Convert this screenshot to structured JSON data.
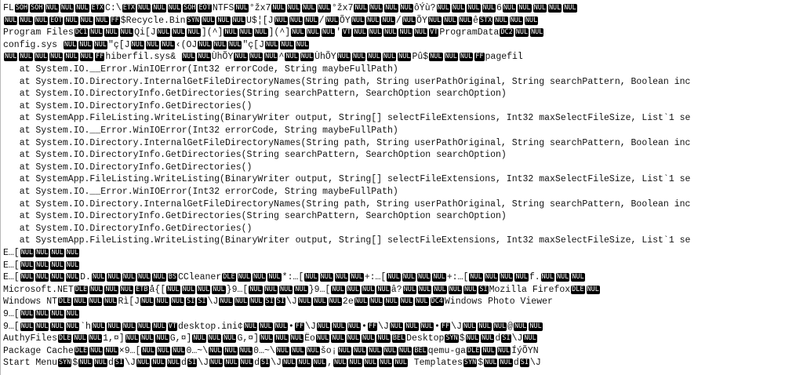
{
  "lines": [
    [
      {
        "c": "FL"
      },
      {
        "k": "SOH"
      },
      {
        "k": "SOH"
      },
      {
        "k": "NUL"
      },
      {
        "k": "NUL"
      },
      {
        "k": "NUL"
      },
      {
        "k": "ETX"
      },
      {
        "t": "C:\\"
      },
      {
        "k": "ETX"
      },
      {
        "k": "NUL"
      },
      {
        "k": "NUL"
      },
      {
        "k": "NUL"
      },
      {
        "k": "SOH"
      },
      {
        "k": "EOT"
      },
      {
        "t": "NTFS"
      },
      {
        "k": "NUL"
      },
      {
        "t": "°žx7"
      },
      {
        "k": "NUL"
      },
      {
        "k": "NUL"
      },
      {
        "k": "NUL"
      },
      {
        "k": "NUL"
      },
      {
        "t": "°žx7"
      },
      {
        "k": "NUL"
      },
      {
        "k": "NUL"
      },
      {
        "k": "NUL"
      },
      {
        "k": "NUL"
      },
      {
        "t": "ôÝù?"
      },
      {
        "k": "NUL"
      },
      {
        "k": "NUL"
      },
      {
        "k": "NUL"
      },
      {
        "k": "NUL"
      },
      {
        "t": "6"
      },
      {
        "k": "NUL"
      },
      {
        "k": "NUL"
      },
      {
        "k": "NUL"
      },
      {
        "k": "NUL"
      },
      {
        "k": "NUL"
      }
    ],
    [
      {
        "k": "NUL"
      },
      {
        "k": "NUL"
      },
      {
        "k": "NUL"
      },
      {
        "k": "EOT"
      },
      {
        "k": "NUL"
      },
      {
        "k": "NUL"
      },
      {
        "k": "NUL"
      },
      {
        "k": "FF"
      },
      {
        "t": "$Recycle.Bin"
      },
      {
        "k": "SYN"
      },
      {
        "k": "NUL"
      },
      {
        "k": "NUL"
      },
      {
        "k": "NUL"
      },
      {
        "t": "U$¦[J"
      },
      {
        "k": "NUL"
      },
      {
        "k": "NUL"
      },
      {
        "k": "NUL"
      },
      {
        "t": "/"
      },
      {
        "k": "NUL"
      },
      {
        "t": "ÕY"
      },
      {
        "k": "NUL"
      },
      {
        "k": "NUL"
      },
      {
        "k": "NUL"
      },
      {
        "t": "/"
      },
      {
        "k": "NUL"
      },
      {
        "t": "ÕY"
      },
      {
        "k": "NUL"
      },
      {
        "k": "NUL"
      },
      {
        "k": "NUL"
      },
      {
        "t": "ê"
      },
      {
        "k": "STX"
      },
      {
        "k": "NUL"
      },
      {
        "k": "NUL"
      },
      {
        "k": "NUL"
      }
    ],
    [
      {
        "t": "Program Files"
      },
      {
        "k": "DC1"
      },
      {
        "k": "NUL"
      },
      {
        "k": "NUL"
      },
      {
        "k": "NUL"
      },
      {
        "t": "Qi[J"
      },
      {
        "k": "NUL"
      },
      {
        "k": "NUL"
      },
      {
        "k": "NUL"
      },
      {
        "t": "](^]"
      },
      {
        "k": "NUL"
      },
      {
        "k": "NUL"
      },
      {
        "k": "NUL"
      },
      {
        "t": "](^]"
      },
      {
        "k": "NUL"
      },
      {
        "k": "NUL"
      },
      {
        "k": "NUL"
      },
      {
        "t": "'"
      },
      {
        "k": "VT"
      },
      {
        "k": "NUL"
      },
      {
        "k": "NUL"
      },
      {
        "k": "NUL"
      },
      {
        "k": "NUL"
      },
      {
        "k": "NUL"
      },
      {
        "k": "VT"
      },
      {
        "t": "ProgramData"
      },
      {
        "k": "DC2"
      },
      {
        "k": "NUL"
      },
      {
        "k": "NUL"
      }
    ],
    [
      {
        "t": "config.sys "
      },
      {
        "k": "NUL"
      },
      {
        "k": "NUL"
      },
      {
        "k": "NUL"
      },
      {
        "t": "\"ç[J"
      },
      {
        "k": "NUL"
      },
      {
        "k": "NUL"
      },
      {
        "k": "NUL"
      },
      {
        "t": "‹(OJ"
      },
      {
        "k": "NUL"
      },
      {
        "k": "NUL"
      },
      {
        "k": "NUL"
      },
      {
        "t": "\"ç[J"
      },
      {
        "k": "NUL"
      },
      {
        "k": "NUL"
      },
      {
        "k": "NUL"
      }
    ],
    [
      {
        "k": "NUL"
      },
      {
        "k": "NUL"
      },
      {
        "k": "NUL"
      },
      {
        "k": "NUL"
      },
      {
        "k": "NUL"
      },
      {
        "k": "NUL"
      },
      {
        "k": "FF"
      },
      {
        "t": "hiberfil.sys& "
      },
      {
        "k": "NUL"
      },
      {
        "k": "NUL"
      },
      {
        "t": "ÙhÕY"
      },
      {
        "k": "NUL"
      },
      {
        "k": "NUL"
      },
      {
        "k": "NUL"
      },
      {
        "t": "^"
      },
      {
        "k": "NUL"
      },
      {
        "k": "NUL"
      },
      {
        "t": "ÙhÕY"
      },
      {
        "k": "NUL"
      },
      {
        "k": "NUL"
      },
      {
        "k": "NUL"
      },
      {
        "k": "NUL"
      },
      {
        "k": "NUL"
      },
      {
        "t": "Pû$"
      },
      {
        "k": "NUL"
      },
      {
        "k": "NUL"
      },
      {
        "k": "NUL"
      },
      {
        "k": "FF"
      },
      {
        "t": "pagefil"
      }
    ],
    [
      {
        "t": "   at System.IO.__Error.WinIOError(Int32 errorCode, String maybeFullPath)"
      }
    ],
    [
      {
        "t": "   at System.IO.Directory.InternalGetFileDirectoryNames(String path, String userPathOriginal, String searchPattern, Boolean inc"
      }
    ],
    [
      {
        "t": "   at System.IO.DirectoryInfo.GetDirectories(String searchPattern, SearchOption searchOption)"
      }
    ],
    [
      {
        "t": "   at System.IO.DirectoryInfo.GetDirectories()"
      }
    ],
    [
      {
        "t": "   at SystemApp.FileListing.WriteListing(BinaryWriter output, String[] selectFileExtensions, Int32 maxSelectFileSize, List`1 se"
      }
    ],
    [
      {
        "t": "   at System.IO.__Error.WinIOError(Int32 errorCode, String maybeFullPath)"
      }
    ],
    [
      {
        "t": "   at System.IO.Directory.InternalGetFileDirectoryNames(String path, String userPathOriginal, String searchPattern, Boolean inc"
      }
    ],
    [
      {
        "t": "   at System.IO.DirectoryInfo.GetDirectories(String searchPattern, SearchOption searchOption)"
      }
    ],
    [
      {
        "t": "   at System.IO.DirectoryInfo.GetDirectories()"
      }
    ],
    [
      {
        "t": "   at SystemApp.FileListing.WriteListing(BinaryWriter output, String[] selectFileExtensions, Int32 maxSelectFileSize, List`1 se"
      }
    ],
    [
      {
        "t": "   at System.IO.__Error.WinIOError(Int32 errorCode, String maybeFullPath)"
      }
    ],
    [
      {
        "t": "   at System.IO.Directory.InternalGetFileDirectoryNames(String path, String userPathOriginal, String searchPattern, Boolean inc"
      }
    ],
    [
      {
        "t": "   at System.IO.DirectoryInfo.GetDirectories(String searchPattern, SearchOption searchOption)"
      }
    ],
    [
      {
        "t": "   at System.IO.DirectoryInfo.GetDirectories()"
      }
    ],
    [
      {
        "t": "   at SystemApp.FileListing.WriteListing(BinaryWriter output, String[] selectFileExtensions, Int32 maxSelectFileSize, List`1 se"
      }
    ],
    [
      {
        "t": "E…["
      },
      {
        "k": "NUL"
      },
      {
        "k": "NUL"
      },
      {
        "k": "NUL"
      },
      {
        "k": "NUL"
      }
    ],
    [
      {
        "t": "E…["
      },
      {
        "k": "NUL"
      },
      {
        "k": "NUL"
      },
      {
        "k": "NUL"
      },
      {
        "k": "NUL"
      }
    ],
    [
      {
        "t": "E…["
      },
      {
        "k": "NUL"
      },
      {
        "k": "NUL"
      },
      {
        "k": "NUL"
      },
      {
        "k": "NUL"
      },
      {
        "t": "D."
      },
      {
        "k": "NUL"
      },
      {
        "k": "NUL"
      },
      {
        "k": "NUL"
      },
      {
        "k": "NUL"
      },
      {
        "k": "NUL"
      },
      {
        "k": "BS"
      },
      {
        "t": "CCleaner"
      },
      {
        "k": "DLE"
      },
      {
        "k": "NUL"
      },
      {
        "k": "NUL"
      },
      {
        "k": "NUL"
      },
      {
        "t": "*:…["
      },
      {
        "k": "NUL"
      },
      {
        "k": "NUL"
      },
      {
        "k": "NUL"
      },
      {
        "k": "NUL"
      },
      {
        "t": "+:…["
      },
      {
        "k": "NUL"
      },
      {
        "k": "NUL"
      },
      {
        "k": "NUL"
      },
      {
        "k": "NUL"
      },
      {
        "t": "+:…["
      },
      {
        "k": "NUL"
      },
      {
        "k": "NUL"
      },
      {
        "k": "NUL"
      },
      {
        "k": "NUL"
      },
      {
        "t": "f."
      },
      {
        "k": "NUL"
      },
      {
        "k": "NUL"
      },
      {
        "k": "NUL"
      }
    ],
    [
      {
        "t": "Microsoft.NET"
      },
      {
        "k": "DLE"
      },
      {
        "k": "NUL"
      },
      {
        "k": "NUL"
      },
      {
        "k": "NUL"
      },
      {
        "k": "ETB"
      },
      {
        "t": "å{["
      },
      {
        "k": "NUL"
      },
      {
        "k": "NUL"
      },
      {
        "k": "NUL"
      },
      {
        "k": "NUL"
      },
      {
        "t": "}9…["
      },
      {
        "k": "NUL"
      },
      {
        "k": "NUL"
      },
      {
        "k": "NUL"
      },
      {
        "k": "NUL"
      },
      {
        "t": "}9…["
      },
      {
        "k": "NUL"
      },
      {
        "k": "NUL"
      },
      {
        "k": "NUL"
      },
      {
        "k": "NUL"
      },
      {
        "t": "â?"
      },
      {
        "k": "NUL"
      },
      {
        "k": "NUL"
      },
      {
        "k": "NUL"
      },
      {
        "k": "NUL"
      },
      {
        "k": "NUL"
      },
      {
        "k": "SI"
      },
      {
        "t": "Mozilla Firefox"
      },
      {
        "k": "DLE"
      },
      {
        "k": "NUL"
      }
    ],
    [
      {
        "t": "Windows NT"
      },
      {
        "k": "DLE"
      },
      {
        "k": "NUL"
      },
      {
        "k": "NUL"
      },
      {
        "k": "NUL"
      },
      {
        "t": "Rì[J"
      },
      {
        "k": "NUL"
      },
      {
        "k": "NUL"
      },
      {
        "k": "NUL"
      },
      {
        "k": "SI"
      },
      {
        "k": "SI"
      },
      {
        "t": "\\J"
      },
      {
        "k": "NUL"
      },
      {
        "k": "NUL"
      },
      {
        "k": "NUL"
      },
      {
        "k": "SI"
      },
      {
        "k": "SI"
      },
      {
        "t": "\\J"
      },
      {
        "k": "NUL"
      },
      {
        "k": "NUL"
      },
      {
        "k": "NUL"
      },
      {
        "t": "2e"
      },
      {
        "k": "NUL"
      },
      {
        "k": "NUL"
      },
      {
        "k": "NUL"
      },
      {
        "k": "NUL"
      },
      {
        "k": "NUL"
      },
      {
        "k": "DC4"
      },
      {
        "t": "Windows Photo Viewer"
      }
    ],
    [
      {
        "t": "9…["
      },
      {
        "k": "NUL"
      },
      {
        "k": "NUL"
      },
      {
        "k": "NUL"
      },
      {
        "k": "NUL"
      }
    ],
    [
      {
        "t": "9…["
      },
      {
        "k": "NUL"
      },
      {
        "k": "NUL"
      },
      {
        "k": "NUL"
      },
      {
        "k": "NUL"
      },
      {
        "t": "`h"
      },
      {
        "k": "NUL"
      },
      {
        "k": "NUL"
      },
      {
        "k": "NUL"
      },
      {
        "k": "NUL"
      },
      {
        "k": "NUL"
      },
      {
        "k": "VT"
      },
      {
        "t": "desktop.ini¢"
      },
      {
        "k": "NUL"
      },
      {
        "k": "NUL"
      },
      {
        "k": "NUL"
      },
      {
        "t": "•"
      },
      {
        "k": "FF"
      },
      {
        "t": "\\J"
      },
      {
        "k": "NUL"
      },
      {
        "k": "NUL"
      },
      {
        "k": "NUL"
      },
      {
        "t": "•"
      },
      {
        "k": "FF"
      },
      {
        "t": "\\J"
      },
      {
        "k": "NUL"
      },
      {
        "k": "NUL"
      },
      {
        "k": "NUL"
      },
      {
        "t": "•"
      },
      {
        "k": "FF"
      },
      {
        "t": "\\J"
      },
      {
        "k": "NUL"
      },
      {
        "k": "NUL"
      },
      {
        "k": "NUL"
      },
      {
        "t": "@"
      },
      {
        "k": "NUL"
      },
      {
        "k": "NUL"
      }
    ],
    [
      {
        "t": "AuthyFiles"
      },
      {
        "k": "DLE"
      },
      {
        "k": "NUL"
      },
      {
        "k": "NUL"
      },
      {
        "t": "1,¤]"
      },
      {
        "k": "NUL"
      },
      {
        "k": "NUL"
      },
      {
        "k": "NUL"
      },
      {
        "t": "G,¤]"
      },
      {
        "k": "NUL"
      },
      {
        "k": "NUL"
      },
      {
        "k": "NUL"
      },
      {
        "t": "G,¤]"
      },
      {
        "k": "NUL"
      },
      {
        "k": "NUL"
      },
      {
        "k": "NUL"
      },
      {
        "t": "Ëo"
      },
      {
        "k": "NUL"
      },
      {
        "k": "NUL"
      },
      {
        "k": "NUL"
      },
      {
        "k": "NUL"
      },
      {
        "k": "NUL"
      },
      {
        "k": "BEL"
      },
      {
        "t": "Desktop"
      },
      {
        "k": "SYN"
      },
      {
        "t": "$"
      },
      {
        "k": "NUL"
      },
      {
        "k": "NUL"
      },
      {
        "t": "d"
      },
      {
        "k": "SI"
      },
      {
        "t": "\\J"
      },
      {
        "k": "NUL"
      }
    ],
    [
      {
        "t": "Package Cache"
      },
      {
        "k": "DLE"
      },
      {
        "k": "NUL"
      },
      {
        "k": "NUL"
      },
      {
        "t": "×9…["
      },
      {
        "k": "NUL"
      },
      {
        "k": "NUL"
      },
      {
        "k": "NUL"
      },
      {
        "t": "0…~\\"
      },
      {
        "k": "NUL"
      },
      {
        "k": "NUL"
      },
      {
        "k": "NUL"
      },
      {
        "t": "0…~\\"
      },
      {
        "k": "NUL"
      },
      {
        "k": "NUL"
      },
      {
        "k": "NUL"
      },
      {
        "t": "šo¡"
      },
      {
        "k": "NUL"
      },
      {
        "k": "NUL"
      },
      {
        "k": "NUL"
      },
      {
        "k": "NUL"
      },
      {
        "k": "NUL"
      },
      {
        "k": "BEL"
      },
      {
        "t": "qemu-ga"
      },
      {
        "k": "DLE"
      },
      {
        "k": "NUL"
      },
      {
        "k": "NUL"
      },
      {
        "t": "ÍýÕYN"
      }
    ],
    [
      {
        "t": "Start Menu"
      },
      {
        "k": "SYN"
      },
      {
        "t": "$"
      },
      {
        "k": "NUL"
      },
      {
        "k": "NUL"
      },
      {
        "t": "d"
      },
      {
        "k": "SI"
      },
      {
        "t": "\\J"
      },
      {
        "k": "NUL"
      },
      {
        "k": "NUL"
      },
      {
        "k": "NUL"
      },
      {
        "t": "d"
      },
      {
        "k": "SI"
      },
      {
        "t": "\\J"
      },
      {
        "k": "NUL"
      },
      {
        "k": "NUL"
      },
      {
        "k": "NUL"
      },
      {
        "t": "d"
      },
      {
        "k": "SI"
      },
      {
        "t": "\\J"
      },
      {
        "k": "NUL"
      },
      {
        "k": "NUL"
      },
      {
        "k": "NUL"
      },
      {
        "t": ","
      },
      {
        "k": "NUL"
      },
      {
        "k": "NUL"
      },
      {
        "k": "NUL"
      },
      {
        "k": "NUL"
      },
      {
        "k": "NUL"
      },
      {
        "t": " Templates"
      },
      {
        "k": "SYN"
      },
      {
        "t": "$"
      },
      {
        "k": "NUL"
      },
      {
        "k": "NUL"
      },
      {
        "t": "d"
      },
      {
        "k": "SI"
      },
      {
        "t": "\\J"
      }
    ]
  ]
}
